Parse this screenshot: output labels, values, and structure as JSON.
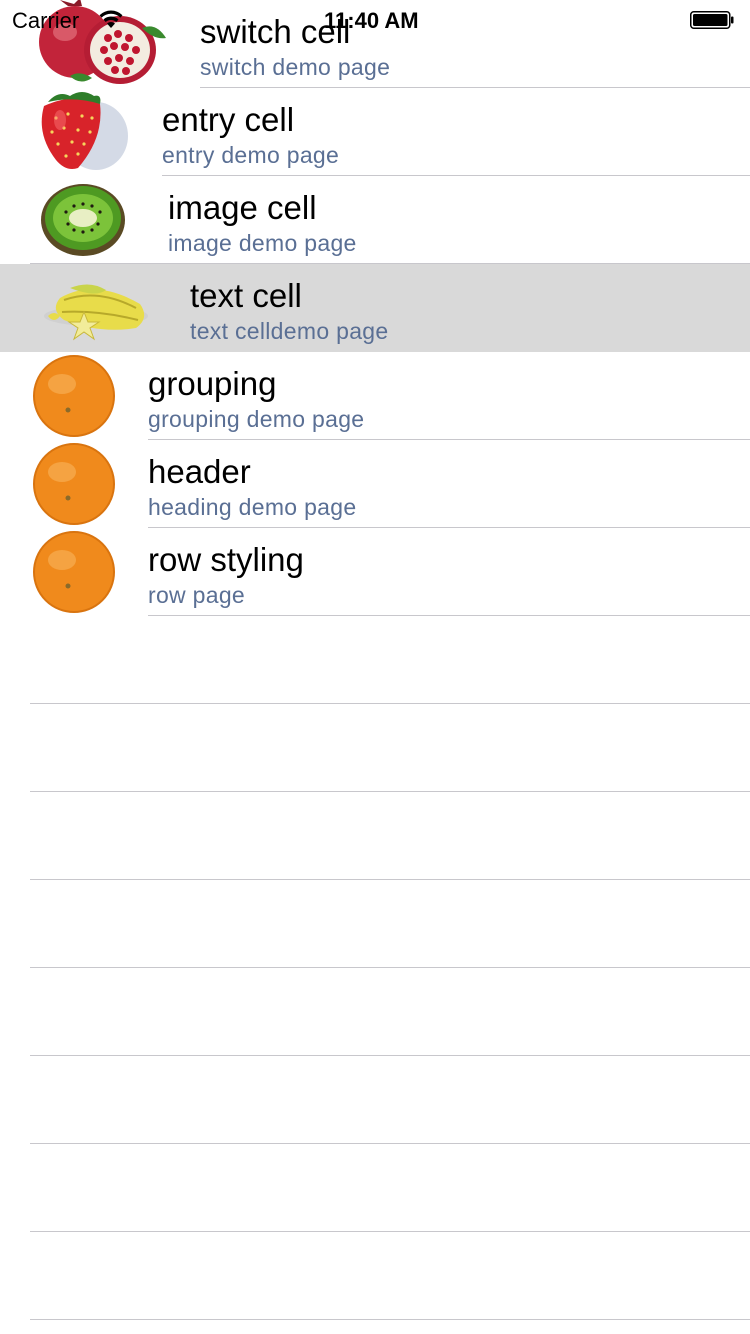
{
  "status_bar": {
    "carrier": "Carrier",
    "time": "11:40 AM"
  },
  "rows": [
    {
      "title": "switch cell",
      "subtitle": "switch demo page",
      "icon": "pomegranate-icon"
    },
    {
      "title": "entry cell",
      "subtitle": "entry demo page",
      "icon": "strawberry-icon"
    },
    {
      "title": "image cell",
      "subtitle": "image demo page",
      "icon": "kiwi-icon"
    },
    {
      "title": "text cell",
      "subtitle": "text celldemo page",
      "icon": "starfruit-icon",
      "selected": true
    },
    {
      "title": "grouping",
      "subtitle": "grouping demo page",
      "icon": "orange-icon"
    },
    {
      "title": "header",
      "subtitle": "heading demo page",
      "icon": "orange-icon"
    },
    {
      "title": "row styling",
      "subtitle": "row page",
      "icon": "orange-icon"
    }
  ],
  "colors": {
    "selected_row": "#d9d9d9",
    "subtitle": "#5a6f94",
    "separator": "#c8c7cc"
  }
}
